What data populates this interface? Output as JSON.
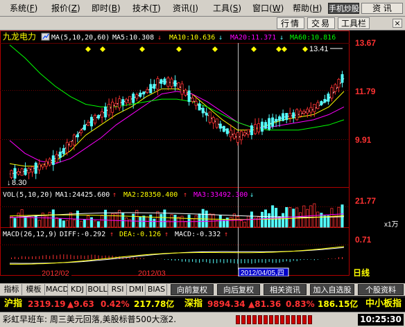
{
  "menu": {
    "items": [
      {
        "label": "系统",
        "key": "F"
      },
      {
        "label": "报价",
        "key": "Z"
      },
      {
        "label": "即时",
        "key": "B"
      },
      {
        "label": "技术",
        "key": "T"
      },
      {
        "label": "资讯",
        "key": "I"
      },
      {
        "label": "工具",
        "key": "S"
      },
      {
        "label": "窗口",
        "key": "W"
      },
      {
        "label": "帮助",
        "key": "H"
      }
    ],
    "mobile_btn": "手机炒股",
    "info_btn": "资 讯"
  },
  "toolbar": {
    "buttons": [
      "行情",
      "交易",
      "工具栏"
    ],
    "close": "×"
  },
  "chart": {
    "stock_name": "九龙电力",
    "ma_label": "MA(5,10,20,60)",
    "ma5": "MA5:10.308",
    "ma10": "MA10:10.636",
    "ma20": "MA20:11.371",
    "ma60": "MA60:10.816",
    "price_ticks": [
      "13.67",
      "11.79",
      "9.91"
    ],
    "high_mark": "13.41",
    "low_mark": "8.30",
    "date_labels": [
      "2012/02",
      "2012/03"
    ],
    "vol_label": "VOL(5,10,20)",
    "vol_ma1": "MA1:24425.600",
    "vol_ma2": "MA2:28350.400",
    "vol_ma3": "MA3:33492.300",
    "vol_tick": "21.77",
    "vol_unit": "x1万",
    "macd_label": "MACD(26,12,9)",
    "diff": "DIFF:-0.292",
    "dea": "DEA:-0.126",
    "macd": "MACD:-0.332",
    "macd_tick": "0.71",
    "cursor_date": "2012/04/05,四",
    "period": "日线",
    "colors": {
      "up": "#ff3232",
      "down": "#54ffff",
      "ma5": "#ffffff",
      "ma10": "#ffff00",
      "ma20": "#ff00ff",
      "ma60": "#00ff00",
      "axis": "#b00000"
    }
  },
  "chart_data": {
    "type": "candlestick",
    "series": [
      {
        "name": "MA5",
        "values": [
          8.7,
          8.8,
          9.0,
          9.3,
          9.9,
          10.6,
          11.0,
          11.4,
          11.6,
          11.9,
          12.3,
          12.2,
          11.6,
          11.0,
          10.5,
          10.1,
          10.4,
          10.6,
          10.9,
          11.0,
          11.2,
          11.6,
          12.4
        ]
      },
      {
        "name": "MA10",
        "values": [
          9.1,
          9.0,
          9.0,
          9.2,
          9.6,
          10.2,
          10.6,
          11.0,
          11.3,
          11.7,
          12.0,
          12.0,
          11.8,
          11.3,
          10.8,
          10.4,
          10.4,
          10.6,
          10.8,
          10.9,
          11.0,
          11.3,
          11.9
        ]
      },
      {
        "name": "MA20",
        "values": [
          10.0,
          9.5,
          9.2,
          9.1,
          9.3,
          9.7,
          10.1,
          10.6,
          11.0,
          11.4,
          11.8,
          11.9,
          11.8,
          11.5,
          11.1,
          10.7,
          10.5,
          10.5,
          10.6,
          10.7,
          10.8,
          11.0,
          11.3
        ]
      },
      {
        "name": "MA60",
        "values": [
          13.7,
          13.2,
          12.6,
          12.1,
          11.7,
          11.4,
          11.3,
          11.3,
          11.4,
          11.5,
          11.6,
          11.6,
          11.5,
          11.3,
          11.0,
          10.7,
          10.5,
          10.4,
          10.4,
          10.4,
          10.5,
          10.6,
          10.8
        ]
      }
    ],
    "ylim": [
      8.3,
      13.67
    ],
    "x_ticks": [
      "2012/02",
      "2012/03"
    ],
    "legend": "top"
  },
  "bottom_tabs": [
    "指标",
    "模板",
    "MACD",
    "KDJ",
    "BOLL",
    "RSI",
    "DMI",
    "BIAS",
    "向前复权",
    "向后复权",
    "相关资讯",
    "加入自选股",
    "个股资料"
  ],
  "ticker": {
    "sh_name": "沪指",
    "sh_value": "2319.19",
    "sh_change": "▲9.63",
    "sh_pct": "0.42%",
    "sh_amount": "217.78亿",
    "sz_name": "深指",
    "sz_value": "9894.34",
    "sz_change": "▲81.36",
    "sz_pct": "0.83%",
    "sz_amount": "186.15亿",
    "sme_name": "中小板指"
  },
  "status": {
    "message": "彩虹早班车: 周三美元回落,美股标普500大涨2.",
    "time": "10:25:30"
  }
}
